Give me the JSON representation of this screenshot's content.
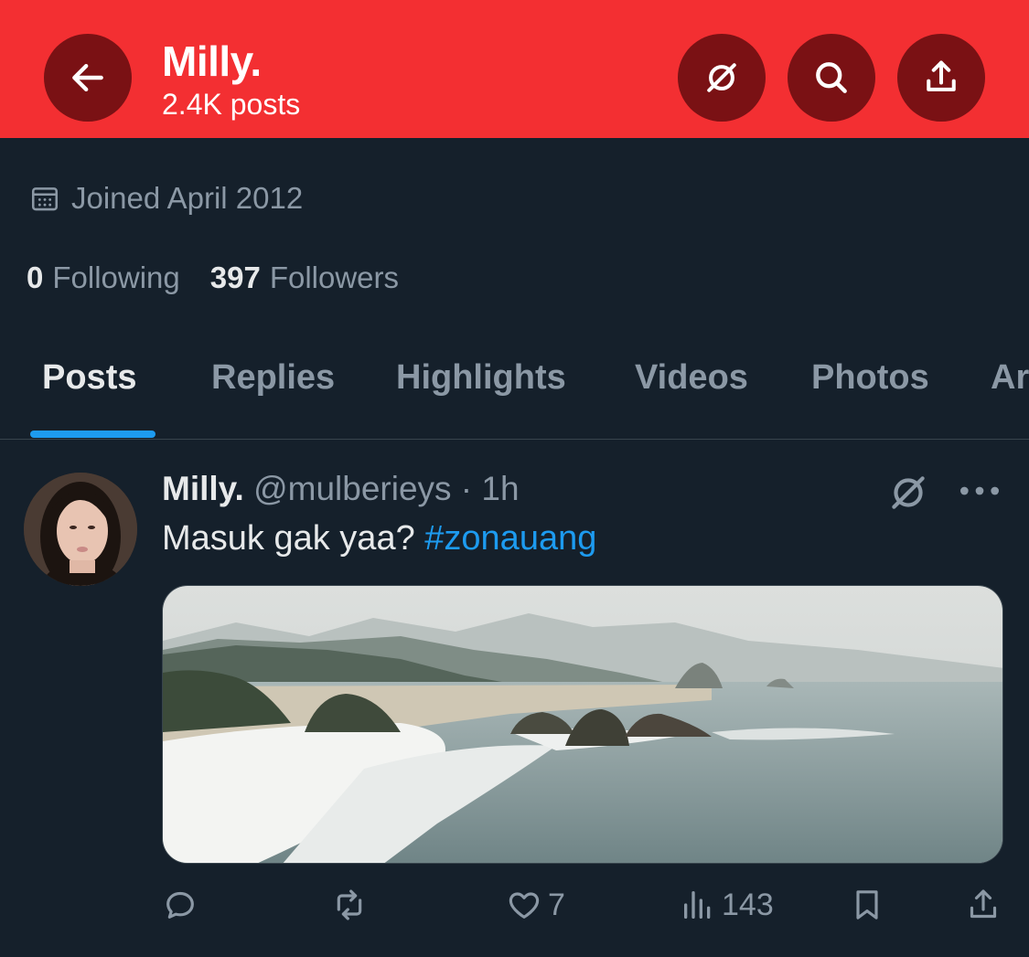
{
  "header": {
    "name": "Milly.",
    "post_count": "2.4K posts",
    "background": "#f32f32",
    "button_bg": "#7a1114",
    "icons": [
      "arrow-left-icon",
      "grok-icon",
      "search-icon",
      "share-icon"
    ]
  },
  "profile": {
    "joined": "Joined April 2012",
    "following_count": "0",
    "following_label": "Following",
    "followers_count": "397",
    "followers_label": "Followers"
  },
  "tabs": [
    {
      "label": "Posts",
      "active": true
    },
    {
      "label": "Replies",
      "active": false
    },
    {
      "label": "Highlights",
      "active": false
    },
    {
      "label": "Videos",
      "active": false
    },
    {
      "label": "Photos",
      "active": false
    },
    {
      "label": "Ar",
      "active": false
    }
  ],
  "post": {
    "name": "Milly.",
    "meta": "@mulberieys · 1h",
    "text": "Masuk gak yaa?",
    "hashtag": "#zonauang",
    "actions": {
      "reply": "",
      "repost": "",
      "likes": "7",
      "views": "143"
    }
  },
  "colors": {
    "background": "#15202b",
    "accent": "#1d9bf0",
    "muted_text": "#8b98a5",
    "text": "#e7e9ea"
  }
}
